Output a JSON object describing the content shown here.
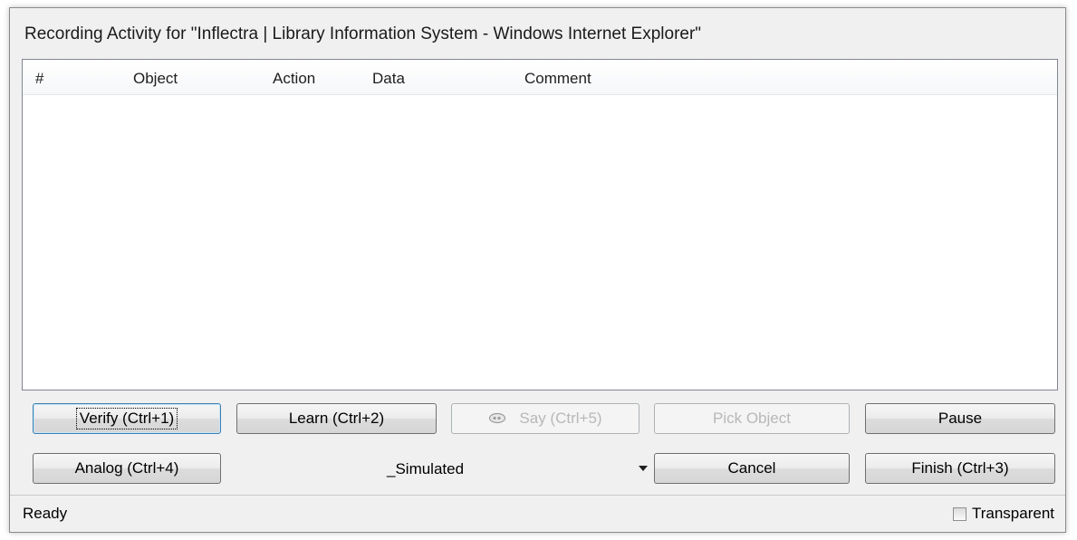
{
  "window": {
    "title": "Recording Activity for \"Inflectra | Library Information System - Windows Internet Explorer\""
  },
  "list": {
    "columns": [
      "#",
      "Object",
      "Action",
      "Data",
      "Comment"
    ],
    "rows": []
  },
  "buttons": {
    "verify": "Verify (Ctrl+1)",
    "learn": "Learn (Ctrl+2)",
    "say": "Say (Ctrl+5)",
    "pick_object": "Pick Object",
    "pause": "Pause",
    "analog": "Analog (Ctrl+4)",
    "cancel": "Cancel",
    "finish": "Finish (Ctrl+3)"
  },
  "mode_select": {
    "value": "_Simulated"
  },
  "status": {
    "text": "Ready",
    "transparent_label": "Transparent",
    "transparent_checked": false
  },
  "icons": {
    "say": "speech-bubble-icon",
    "dropdown": "chevron-down-icon"
  }
}
